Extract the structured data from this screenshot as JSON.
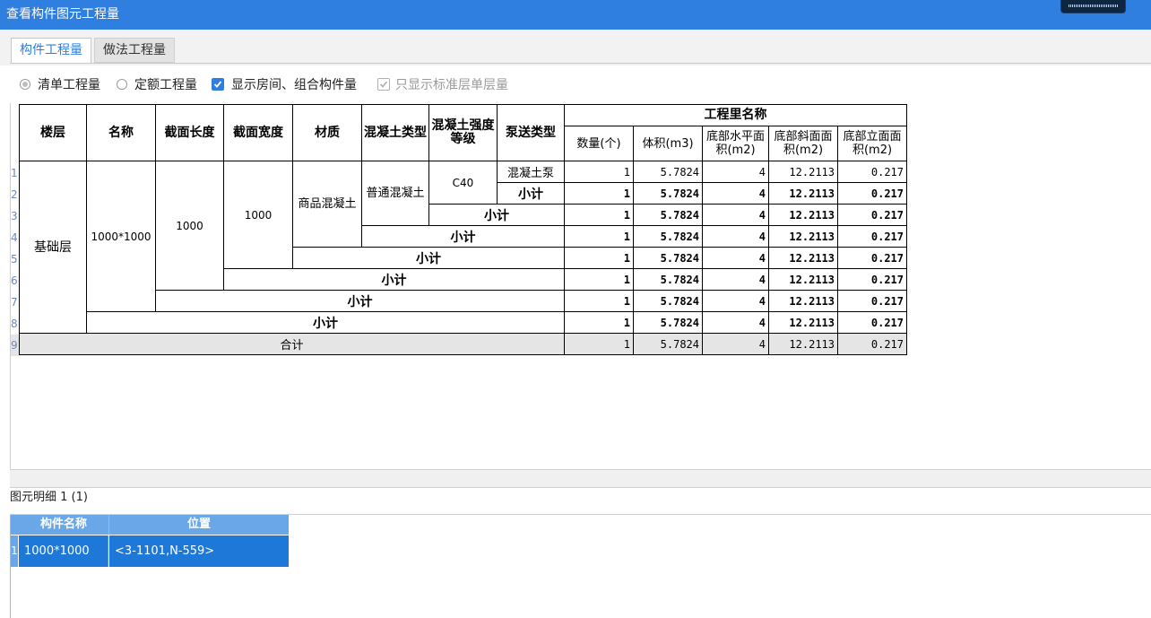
{
  "window": {
    "title": "查看构件图元工程量"
  },
  "tabs": [
    {
      "label": "构件工程量"
    },
    {
      "label": "做法工程量"
    }
  ],
  "options": {
    "list_qty": "清单工程量",
    "quota_qty": "定额工程量",
    "show_rooms": "显示房间、组合构件量",
    "only_std": "只显示标准层单层量"
  },
  "table": {
    "headers": {
      "floor": "楼层",
      "name": "名称",
      "sec_len": "截面长度",
      "sec_wid": "截面宽度",
      "material": "材质",
      "conc_type": "混凝土类型",
      "conc_grade": "混凝土强度等级",
      "pump": "泵送类型",
      "qty_group": "工程里名称",
      "count": "数量(个)",
      "volume": "体积(m3)",
      "bot_h": "底部水平面积(m2)",
      "bot_s": "底部斜面面积(m2)",
      "bot_v": "底部立面面积(m2)"
    },
    "row_numbers": [
      "1",
      "2",
      "3",
      "4",
      "5",
      "6",
      "7",
      "8",
      "9"
    ],
    "cells": {
      "floor": "基础层",
      "name": "1000*1000",
      "sec_len": "1000",
      "sec_wid": "1000",
      "material": "商品混凝土",
      "conc_type": "普通混凝土",
      "conc_grade": "C40",
      "pump": "混凝土泵",
      "subtotal": "小计",
      "total": "合计"
    },
    "rows": [
      {
        "count": "1",
        "volume": "5.7824",
        "bot_h": "4",
        "bot_s": "12.2113",
        "bot_v": "0.217"
      },
      {
        "count": "1",
        "volume": "5.7824",
        "bot_h": "4",
        "bot_s": "12.2113",
        "bot_v": "0.217"
      },
      {
        "count": "1",
        "volume": "5.7824",
        "bot_h": "4",
        "bot_s": "12.2113",
        "bot_v": "0.217"
      },
      {
        "count": "1",
        "volume": "5.7824",
        "bot_h": "4",
        "bot_s": "12.2113",
        "bot_v": "0.217"
      },
      {
        "count": "1",
        "volume": "5.7824",
        "bot_h": "4",
        "bot_s": "12.2113",
        "bot_v": "0.217"
      },
      {
        "count": "1",
        "volume": "5.7824",
        "bot_h": "4",
        "bot_s": "12.2113",
        "bot_v": "0.217"
      },
      {
        "count": "1",
        "volume": "5.7824",
        "bot_h": "4",
        "bot_s": "12.2113",
        "bot_v": "0.217"
      },
      {
        "count": "1",
        "volume": "5.7824",
        "bot_h": "4",
        "bot_s": "12.2113",
        "bot_v": "0.217"
      },
      {
        "count": "1",
        "volume": "5.7824",
        "bot_h": "4",
        "bot_s": "12.2113",
        "bot_v": "0.217"
      }
    ]
  },
  "detail": {
    "label": "图元明细",
    "count": "1 (1)",
    "headers": {
      "name": "构件名称",
      "position": "位置"
    },
    "rows": [
      {
        "num": "1",
        "name": "1000*1000",
        "position": "<3-1101,N-559>"
      }
    ]
  },
  "colors": {
    "titlebar": "#2f7fe0",
    "accent": "#2f7fe0",
    "selected_row": "#1e78d8",
    "header_row": "#6aa7e8"
  }
}
